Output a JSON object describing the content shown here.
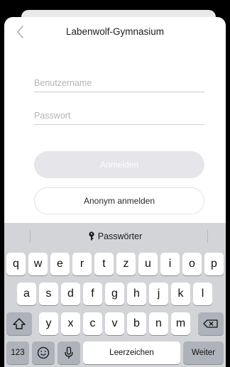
{
  "header": {
    "title": "Labenwolf-Gymnasium",
    "back_icon": "chevron-left-icon"
  },
  "form": {
    "username_placeholder": "Benutzername",
    "password_placeholder": "Passwort",
    "login_label": "Anmelden",
    "anonymous_login_label": "Anonym anmelden"
  },
  "keyboard": {
    "suggestion": "Passwörter",
    "row1": [
      "q",
      "w",
      "e",
      "r",
      "t",
      "z",
      "u",
      "i",
      "o",
      "p"
    ],
    "row2": [
      "a",
      "s",
      "d",
      "f",
      "g",
      "h",
      "j",
      "k",
      "l"
    ],
    "row3": [
      "y",
      "x",
      "c",
      "v",
      "b",
      "n",
      "m"
    ],
    "numbers_label": "123",
    "space_label": "Leerzeichen",
    "return_label": "Weiter"
  },
  "colors": {
    "accent_disabled": "#e6e6ea",
    "keyboard_bg": "#d2d4d8"
  }
}
